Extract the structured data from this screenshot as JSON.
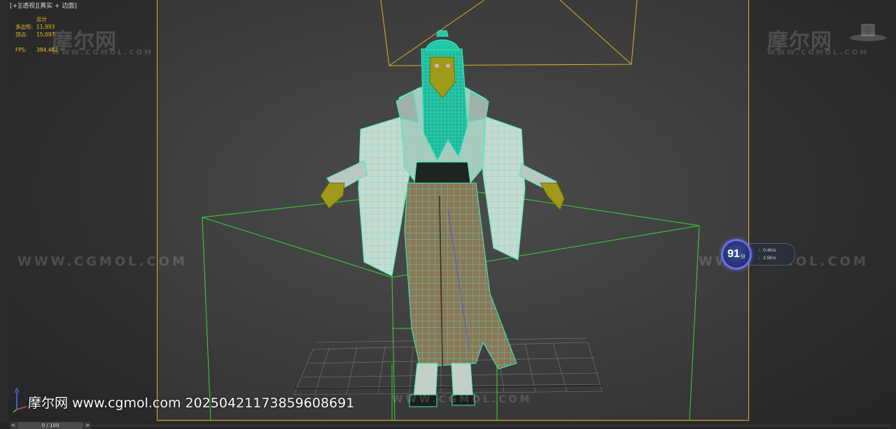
{
  "viewport": {
    "label": "[+][透视][真实 + 边面]",
    "stats": {
      "header": "总计",
      "polys_label": "多边形:",
      "polys_value": "11,993",
      "verts_label": "顶点:",
      "verts_value": "15,097",
      "fps_label": "FPS:",
      "fps_value": "384.482"
    }
  },
  "watermarks": {
    "brand": "摩尔网",
    "url_small": "WWW.CGMOL.COM",
    "url_large": "WWW.CGMOL.COM"
  },
  "network_widget": {
    "score": "91",
    "unit": "分",
    "upload": "0.4K/s",
    "download": "2.5K/s"
  },
  "caption": "摩尔网 www.cgmol.com 20250421173859608691",
  "timeline": {
    "slider_label": "0 / 100",
    "prev_label": "<",
    "next_label": ">"
  },
  "colors": {
    "safe_frame": "#d8b12a",
    "stats_text": "#e7c028",
    "wireframe": "#3ef0c0",
    "bounding_box": "#39d631",
    "camera": "#d8b12a",
    "skin": "#a09a1a"
  },
  "icons": {
    "axis": "axis-tripod-icon",
    "logo": "cgmol-logo-icon"
  }
}
